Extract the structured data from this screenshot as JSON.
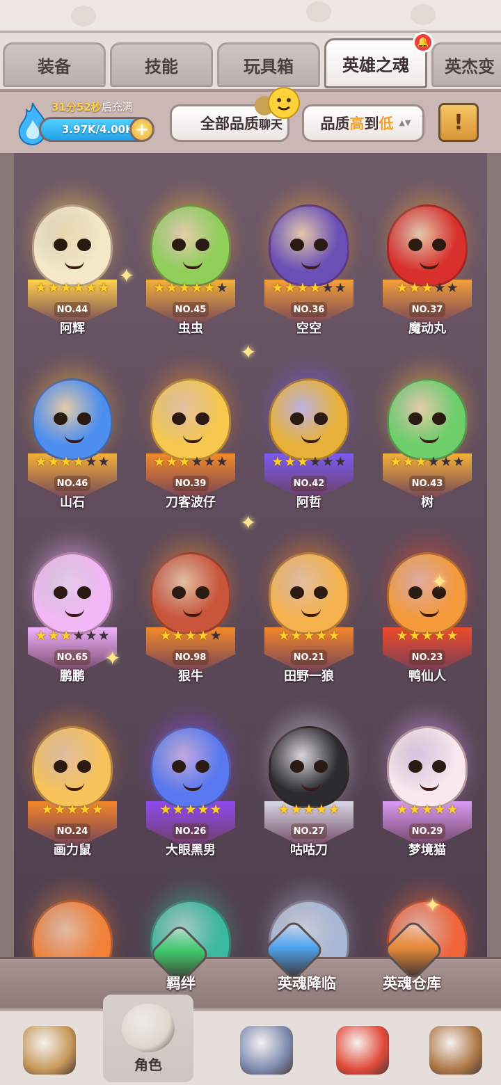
{
  "tabs": [
    {
      "label": "装备",
      "active": false
    },
    {
      "label": "技能",
      "active": false
    },
    {
      "label": "玩具箱",
      "active": false
    },
    {
      "label": "英雄之魂",
      "active": true,
      "notification": "bell"
    },
    {
      "label": "英杰变",
      "active": false
    }
  ],
  "toolbar": {
    "timer_time": "31分52秒",
    "timer_suffix": "后充满",
    "energy": "3.97K/4.00K",
    "energy_plus": "+",
    "quality_filter": "全部品质",
    "chat_label": "聊天",
    "sort_prefix": "品质",
    "sort_high": "高",
    "sort_mid": "到",
    "sort_low": "低",
    "sort_arrows": "▲▼",
    "book_glyph": "!"
  },
  "heroes": [
    {
      "name": "阿辉",
      "no": "NO.44",
      "stars": 6,
      "max": 6,
      "color": "#f5e9c8",
      "glow": "#ffd34d"
    },
    {
      "name": "虫虫",
      "no": "NO.45",
      "stars": 5,
      "max": 6,
      "color": "#8fcf5a",
      "glow": "#f5b13a"
    },
    {
      "name": "空空",
      "no": "NO.36",
      "stars": 4,
      "max": 6,
      "color": "#6a4fb5",
      "glow": "#f5a03a"
    },
    {
      "name": "魔动丸",
      "no": "NO.37",
      "stars": 3,
      "max": 5,
      "color": "#d9302b",
      "glow": "#f5a03a"
    },
    {
      "name": "山石",
      "no": "NO.46",
      "stars": 4,
      "max": 6,
      "color": "#4d8ff0",
      "glow": "#f5b13a"
    },
    {
      "name": "刀客波仔",
      "no": "NO.39",
      "stars": 3,
      "max": 6,
      "color": "#f6c84d",
      "glow": "#f58a2a"
    },
    {
      "name": "阿哲",
      "no": "NO.42",
      "stars": 3,
      "max": 6,
      "color": "#e8b23a",
      "glow": "#7b5cf0"
    },
    {
      "name": "树",
      "no": "NO.43",
      "stars": 3,
      "max": 6,
      "color": "#6ccf6a",
      "glow": "#f5b13a"
    },
    {
      "name": "鹏鹏",
      "no": "NO.65",
      "stars": 3,
      "max": 6,
      "color": "#f1b8f5",
      "glow": "#f0b3ff"
    },
    {
      "name": "狠牛",
      "no": "NO.98",
      "stars": 4,
      "max": 5,
      "color": "#c9553a",
      "glow": "#f58a2a"
    },
    {
      "name": "田野一狼",
      "no": "NO.21",
      "stars": 5,
      "max": 5,
      "color": "#f6b24d",
      "glow": "#f5872a"
    },
    {
      "name": "鸭仙人",
      "no": "NO.23",
      "stars": 5,
      "max": 5,
      "color": "#f59a3a",
      "glow": "#ef4a2a"
    },
    {
      "name": "画力鼠",
      "no": "NO.24",
      "stars": 5,
      "max": 5,
      "color": "#f7c35a",
      "glow": "#f5872a"
    },
    {
      "name": "大眼黑男",
      "no": "NO.26",
      "stars": 5,
      "max": 5,
      "color": "#5a78f0",
      "glow": "#8f4af0"
    },
    {
      "name": "咕咕刀",
      "no": "NO.27",
      "stars": 5,
      "max": 5,
      "color": "#2b2b30",
      "glow": "#d9d9e8"
    },
    {
      "name": "梦境猫",
      "no": "NO.29",
      "stars": 5,
      "max": 5,
      "color": "#fbe8ee",
      "glow": "#d99bf5"
    }
  ],
  "partial_row_colors": [
    "#f2823a",
    "#3ab8a0",
    "#a9b8d6",
    "#f0643a"
  ],
  "actions": [
    {
      "label": "羁绊",
      "gem": "#3fc76a"
    },
    {
      "label": "英魂降临",
      "gem": "#4fa4f0"
    },
    {
      "label": "英魂仓库",
      "gem": "#e88b3a"
    }
  ],
  "bottom_nav": [
    {
      "label": "",
      "icon": "viking-icon",
      "color": "#c79a5a"
    },
    {
      "label": "角色",
      "icon": "hero-avatar-icon",
      "color": "#e0d6ce",
      "active": true
    },
    {
      "label": "",
      "icon": "sword-shield-icon",
      "color": "#7f8bb0"
    },
    {
      "label": "",
      "icon": "dino-icon",
      "color": "#e24a3a"
    },
    {
      "label": "",
      "icon": "castle-icon",
      "color": "#b07a4a"
    }
  ]
}
